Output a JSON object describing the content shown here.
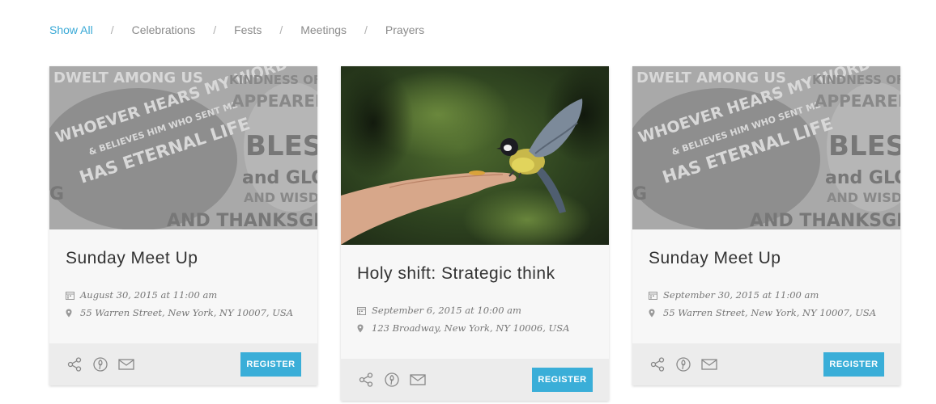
{
  "filters": [
    {
      "label": "Show All",
      "active": true
    },
    {
      "label": "Celebrations",
      "active": false
    },
    {
      "label": "Fests",
      "active": false
    },
    {
      "label": "Meetings",
      "active": false
    },
    {
      "label": "Prayers",
      "active": false
    }
  ],
  "separator": "/",
  "poster_text": {
    "line1": "DWELT AMONG US",
    "line2": "WHOEVER HEARS MY WORD",
    "line3": "& BELIEVES HIM WHO SENT ME",
    "line4": "HAS ETERNAL LIFE",
    "line5": "KINDNESS OF GOD",
    "line6": "APPEARED, HE",
    "line7": "BLESS",
    "line8": "and GLO",
    "line9": "AND WISDO",
    "line10": "AND THANKSGIV",
    "line11": "G"
  },
  "cards": [
    {
      "title": "Sunday Meet Up",
      "date": "August 30, 2015 at 11:00 am",
      "address": "55 Warren Street, New York, NY 10007, USA",
      "button": "REGISTER"
    },
    {
      "title": "Holy shift: Strategic think",
      "date": "September 6, 2015 at 10:00 am",
      "address": "123 Broadway, New York, NY 10006, USA",
      "button": "REGISTER"
    },
    {
      "title": "Sunday Meet Up",
      "date": "September 30, 2015 at 11:00 am",
      "address": "55 Warren Street, New York, NY 10007, USA",
      "button": "REGISTER"
    }
  ],
  "icons": {
    "calendar": "calendar-icon",
    "location": "map-pin-icon",
    "share": "share-icon",
    "pinterest": "pinterest-icon",
    "email": "mail-icon"
  },
  "colors": {
    "accent": "#3aaed8",
    "active_filter": "#3aa9d6",
    "card_bg": "#f7f7f7",
    "footer_bg": "#ececec"
  }
}
